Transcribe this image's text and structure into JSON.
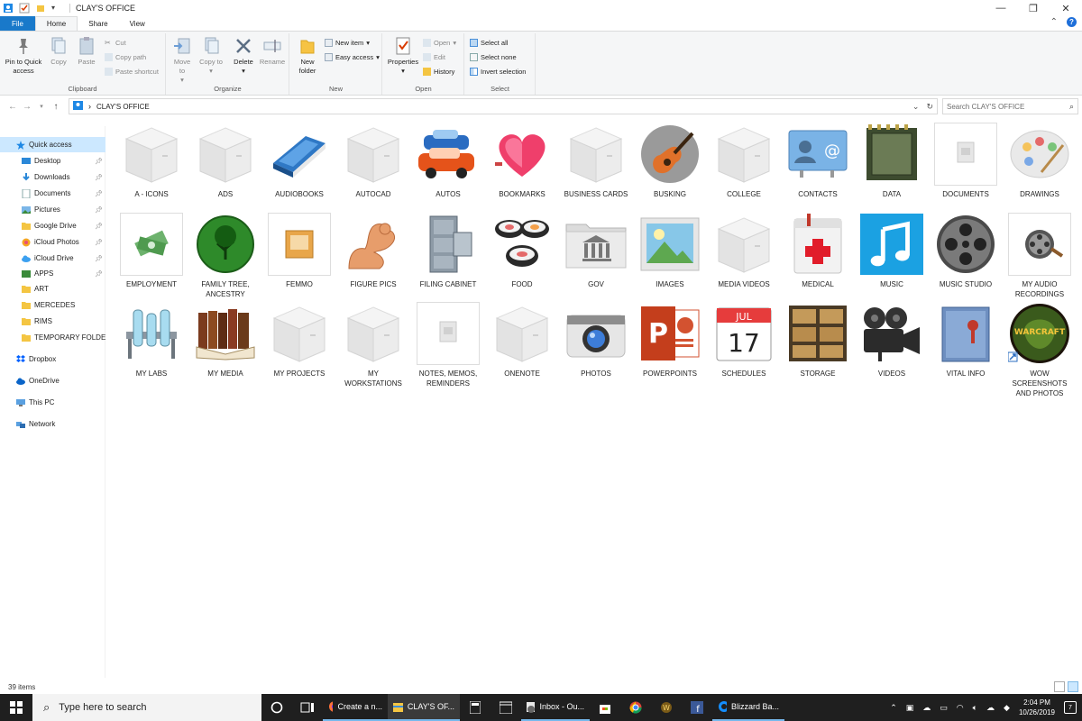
{
  "window": {
    "title": "CLAY'S OFFICE"
  },
  "tabs": {
    "file": "File",
    "home": "Home",
    "share": "Share",
    "view": "View"
  },
  "ribbon": {
    "clipboard": {
      "label": "Clipboard",
      "pin": "Pin to Quick access",
      "copy": "Copy",
      "paste": "Paste",
      "cut": "Cut",
      "copy_path": "Copy path",
      "paste_shortcut": "Paste shortcut"
    },
    "organize": {
      "label": "Organize",
      "move_to": "Move to",
      "copy_to": "Copy to",
      "delete": "Delete",
      "rename": "Rename"
    },
    "new": {
      "label": "New",
      "new_folder": "New folder",
      "new_item": "New item",
      "easy_access": "Easy access"
    },
    "open": {
      "label": "Open",
      "properties": "Properties",
      "open": "Open",
      "edit": "Edit",
      "history": "History"
    },
    "select": {
      "label": "Select",
      "select_all": "Select all",
      "select_none": "Select none",
      "invert": "Invert selection"
    }
  },
  "address": {
    "path": "CLAY'S OFFICE",
    "search_placeholder": "Search CLAY'S OFFICE"
  },
  "sidebar": {
    "items": [
      {
        "label": "Quick access",
        "icon": "star-icon",
        "pinned": false
      },
      {
        "label": "Desktop",
        "icon": "desktop-icon",
        "pinned": true
      },
      {
        "label": "Downloads",
        "icon": "download-icon",
        "pinned": true
      },
      {
        "label": "Documents",
        "icon": "documents-icon",
        "pinned": true
      },
      {
        "label": "Pictures",
        "icon": "pictures-icon",
        "pinned": true
      },
      {
        "label": "Google Drive",
        "icon": "folder-icon",
        "pinned": true
      },
      {
        "label": "iCloud Photos",
        "icon": "icloud-photos-icon",
        "pinned": true
      },
      {
        "label": "iCloud Drive",
        "icon": "icloud-icon",
        "pinned": true
      },
      {
        "label": "APPS",
        "icon": "apps-icon",
        "pinned": true
      },
      {
        "label": "ART",
        "icon": "folder-icon",
        "pinned": false
      },
      {
        "label": "MERCEDES",
        "icon": "folder-icon",
        "pinned": false
      },
      {
        "label": "RIMS",
        "icon": "folder-icon",
        "pinned": false
      },
      {
        "label": "TEMPORARY FOLDE",
        "icon": "folder-icon",
        "pinned": false
      },
      {
        "label": "Dropbox",
        "icon": "dropbox-icon",
        "pinned": false
      },
      {
        "label": "OneDrive",
        "icon": "onedrive-icon",
        "pinned": false
      },
      {
        "label": "This PC",
        "icon": "pc-icon",
        "pinned": false
      },
      {
        "label": "Network",
        "icon": "network-icon",
        "pinned": false
      }
    ]
  },
  "folders": [
    {
      "label": "A - ICONS",
      "icon": "white-box-icon"
    },
    {
      "label": "ADS",
      "icon": "white-box-icon"
    },
    {
      "label": "AUDIOBOOKS",
      "icon": "blue-book-icon"
    },
    {
      "label": "AUTOCAD",
      "icon": "white-box-icon"
    },
    {
      "label": "AUTOS",
      "icon": "cars-icon"
    },
    {
      "label": "BOOKMARKS",
      "icon": "heart-box-icon"
    },
    {
      "label": "BUSINESS CARDS",
      "icon": "white-box-icon"
    },
    {
      "label": "BUSKING",
      "icon": "guitar-icon"
    },
    {
      "label": "COLLEGE",
      "icon": "white-box-icon"
    },
    {
      "label": "CONTACTS",
      "icon": "contacts-card-icon"
    },
    {
      "label": "DATA",
      "icon": "chip-icon"
    },
    {
      "label": "DOCUMENTS",
      "icon": "generic-file-icon"
    },
    {
      "label": "DRAWINGS",
      "icon": "palette-icon"
    },
    {
      "label": "EMPLOYMENT",
      "icon": "money-icon"
    },
    {
      "label": "FAMILY TREE, ANCESTRY",
      "icon": "tree-globe-icon"
    },
    {
      "label": "FEMMO",
      "icon": "photo-box-icon"
    },
    {
      "label": "FIGURE PICS",
      "icon": "flexed-arm-icon"
    },
    {
      "label": "FILING CABINET",
      "icon": "filing-cabinet-icon"
    },
    {
      "label": "FOOD",
      "icon": "sushi-icon"
    },
    {
      "label": "GOV",
      "icon": "government-folder-icon"
    },
    {
      "label": "IMAGES",
      "icon": "landscape-image-icon"
    },
    {
      "label": "MEDIA VIDEOS",
      "icon": "white-box-icon"
    },
    {
      "label": "MEDICAL",
      "icon": "medical-book-icon"
    },
    {
      "label": "MUSIC",
      "icon": "music-note-icon"
    },
    {
      "label": "MUSIC STUDIO",
      "icon": "film-reel-icon"
    },
    {
      "label": "MY AUDIO RECORDINGS",
      "icon": "reel-file-icon"
    },
    {
      "label": "MY LABS",
      "icon": "lab-rack-icon"
    },
    {
      "label": "MY MEDIA",
      "icon": "old-books-icon"
    },
    {
      "label": "MY PROJECTS",
      "icon": "white-box-icon"
    },
    {
      "label": "MY WORKSTATIONS",
      "icon": "white-box-icon"
    },
    {
      "label": "NOTES, MEMOS, REMINDERS",
      "icon": "generic-file-icon"
    },
    {
      "label": "ONENOTE",
      "icon": "white-box-icon"
    },
    {
      "label": "PHOTOS",
      "icon": "camera-icon"
    },
    {
      "label": "POWERPOINTS",
      "icon": "powerpoint-icon"
    },
    {
      "label": "SCHEDULES",
      "icon": "calendar-icon"
    },
    {
      "label": "STORAGE",
      "icon": "storage-boxes-icon"
    },
    {
      "label": "VIDEOS",
      "icon": "movie-camera-icon"
    },
    {
      "label": "VITAL INFO",
      "icon": "sealed-folder-icon"
    },
    {
      "label": "WOW SCREENSHOTS AND PHOTOS",
      "icon": "warcraft-icon"
    }
  ],
  "calendar": {
    "month": "JUL",
    "day": "17"
  },
  "status": {
    "item_count": "39 items"
  },
  "taskbar": {
    "search_placeholder": "Type here to search",
    "apps": [
      {
        "label": "Create a n...",
        "icon": "firefox-icon",
        "active": false
      },
      {
        "label": "CLAY'S OF...",
        "icon": "file-explorer-icon",
        "active": true
      },
      {
        "label": "Inbox - Ou...",
        "icon": "outlook-icon",
        "active": false
      },
      {
        "label": "Blizzard Ba...",
        "icon": "battlenet-icon",
        "active": false
      }
    ],
    "time": "2:04 PM",
    "date": "10/26/2019",
    "notifications": "7"
  },
  "colors": {
    "accent": "#1979ca",
    "selection": "#cce8ff",
    "taskbar": "#1f1f1f"
  }
}
